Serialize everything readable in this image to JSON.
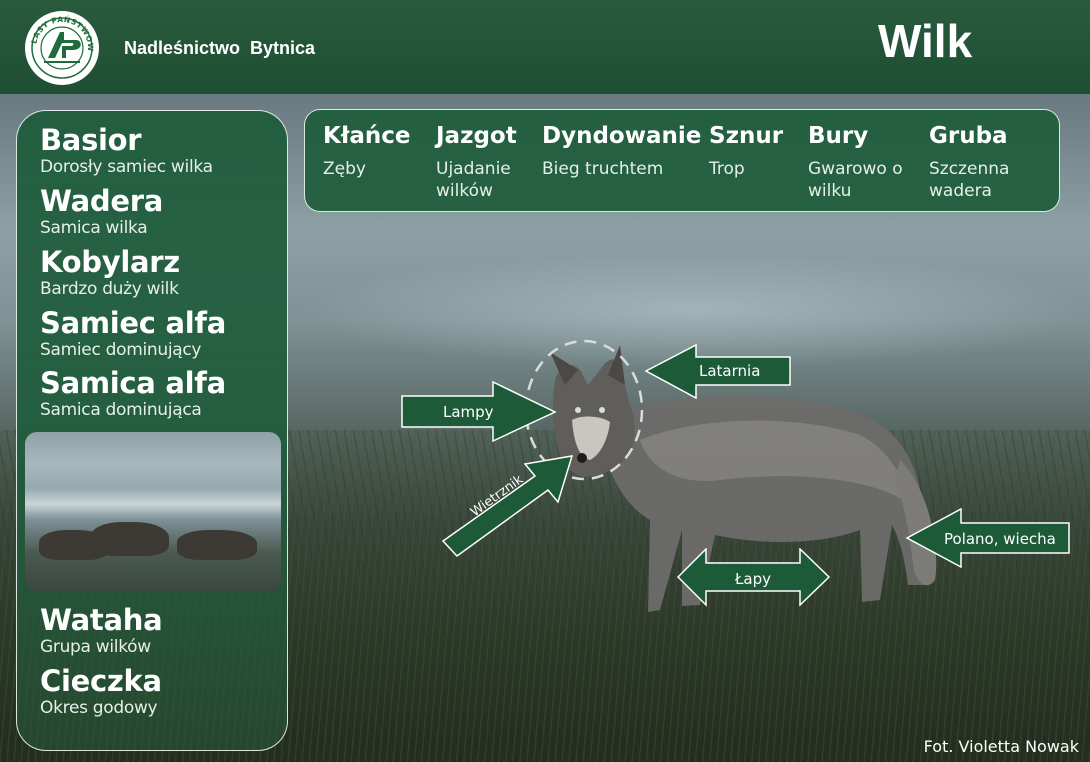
{
  "header": {
    "logo_text": "LASY PAŃSTWOWE",
    "org_name": "Nadleśnictwo  Bytnica",
    "title": "Wilk"
  },
  "left_panel": {
    "terms": [
      {
        "name": "Basior",
        "desc": "Dorosły samiec wilka"
      },
      {
        "name": "Wadera",
        "desc": "Samica wilka"
      },
      {
        "name": "Kobylarz",
        "desc": "Bardzo duży wilk"
      },
      {
        "name": "Samiec alfa",
        "desc": "Samiec dominujący"
      },
      {
        "name": "Samica alfa",
        "desc": "Samica dominująca"
      },
      {
        "name": "Wataha",
        "desc": "Grupa wilków"
      },
      {
        "name": "Cieczka",
        "desc": "Okres godowy"
      }
    ]
  },
  "top_box": {
    "columns": [
      {
        "name": "Kłańce",
        "desc": "Zęby"
      },
      {
        "name": "Jazgot",
        "desc": "Ujadanie wilków"
      },
      {
        "name": "Dyndowanie",
        "desc": "Bieg truchtem"
      },
      {
        "name": "Sznur",
        "desc": "Trop"
      },
      {
        "name": "Bury",
        "desc": "Gwarowo o wilku"
      },
      {
        "name": "Gruba",
        "desc": "Szczenna wadera"
      }
    ]
  },
  "annotations": {
    "latarnia": "Latarnia",
    "lampy": "Lampy",
    "wietrznik": "Wietrznik",
    "lapy": "Łapy",
    "polano": "Polano, wiecha"
  },
  "colors": {
    "header_green": "#245638",
    "panel_green": "#1f5c3c",
    "arrow_green": "#1d5a38"
  },
  "credit": "Fot. Violetta Nowak"
}
